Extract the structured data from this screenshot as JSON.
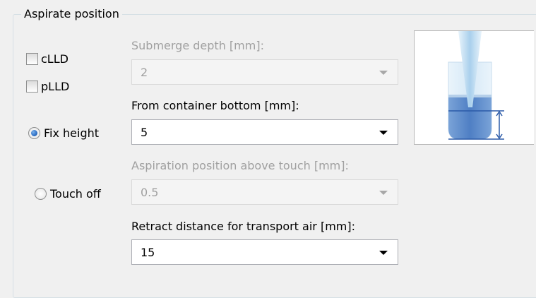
{
  "group": {
    "title": "Aspirate position"
  },
  "checkboxes": [
    {
      "label": "cLLD",
      "checked": false
    },
    {
      "label": "pLLD",
      "checked": false
    }
  ],
  "radios": [
    {
      "label": "Fix height",
      "checked": true
    },
    {
      "label": "Touch off",
      "checked": false
    }
  ],
  "fields": {
    "submerge_depth": {
      "label": "Submerge depth [mm]:",
      "value": "2",
      "enabled": false
    },
    "from_bottom": {
      "label": "From container bottom [mm]:",
      "value": "5",
      "enabled": true
    },
    "above_touch": {
      "label": "Aspiration position above touch [mm]:",
      "value": "0.5",
      "enabled": false
    },
    "retract": {
      "label": "Retract distance for transport air [mm]:",
      "value": "15",
      "enabled": true
    }
  },
  "colors": {
    "liquid": "#5b8ccc",
    "tip": "#cfe6f5",
    "accent": "#2d6fc5"
  }
}
